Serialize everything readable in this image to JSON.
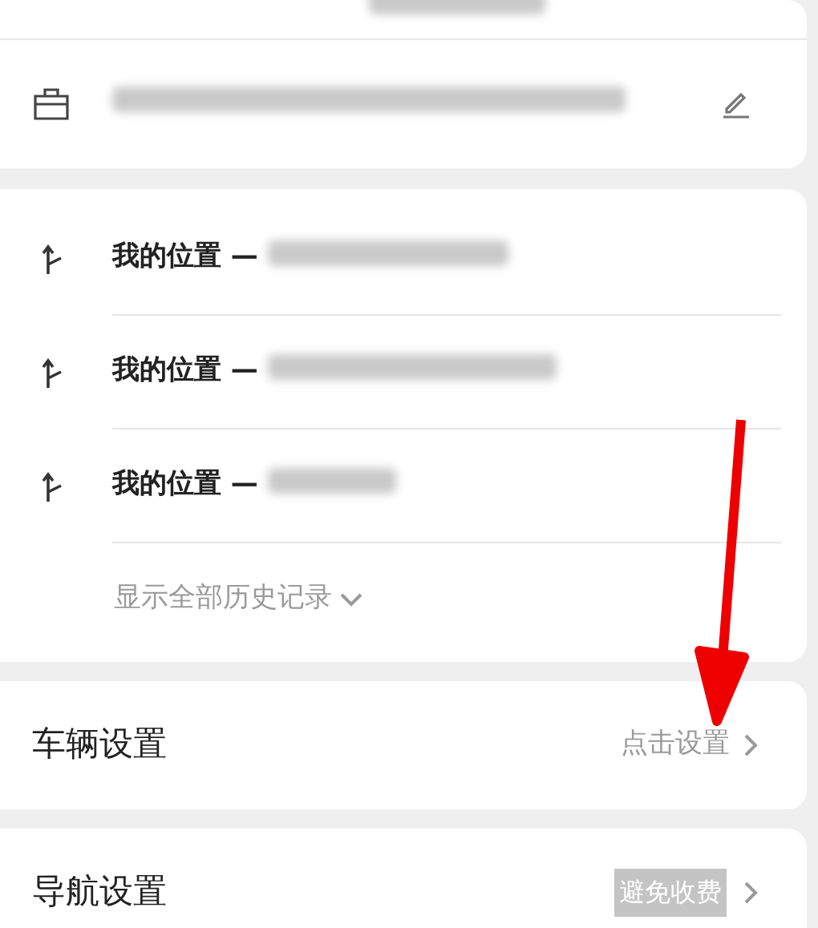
{
  "history": {
    "items": [
      {
        "route": "我的位置 —"
      },
      {
        "route": "我的位置 —"
      },
      {
        "route": "我的位置 —"
      }
    ],
    "show_all": "显示全部历史记录"
  },
  "settings": [
    {
      "label": "车辆设置",
      "kind": "link",
      "value": "点击设置"
    },
    {
      "label": "导航设置",
      "kind": "badge",
      "value": "避免收费"
    }
  ]
}
